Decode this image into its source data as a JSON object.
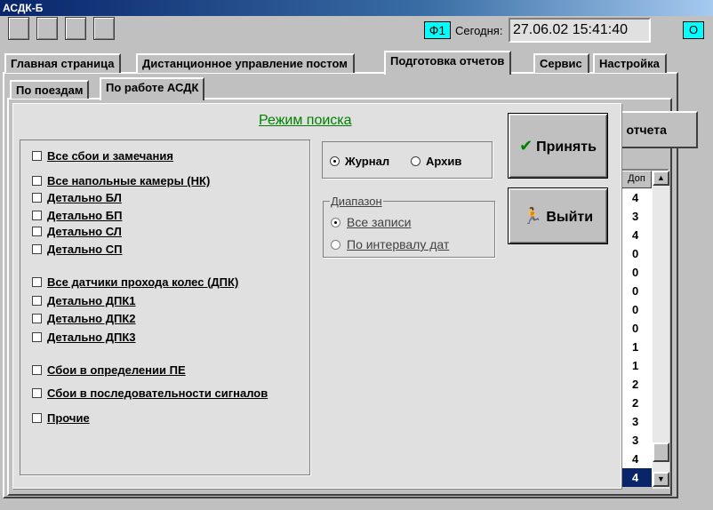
{
  "window": {
    "title": "АСДК-Б"
  },
  "header": {
    "f1_label": "Ф1",
    "today_label": "Сегодня:",
    "datetime": "27.06.02 15:41:40",
    "o_label": "О"
  },
  "main_tabs": [
    {
      "label": "Главная страница"
    },
    {
      "label": "Дистанционное управление постом"
    },
    {
      "label": "Подготовка отчетов"
    },
    {
      "label": "Сервис"
    },
    {
      "label": "Настройка"
    }
  ],
  "sub_tabs": [
    {
      "label": "По поездам"
    },
    {
      "label": "По работе АСДК"
    }
  ],
  "background": {
    "report_button_label": "ь отчета",
    "grid_header": "Доп",
    "grid_values": [
      "4",
      "3",
      "4",
      "0",
      "0",
      "0",
      "0",
      "0",
      "1",
      "1",
      "2",
      "2",
      "3",
      "3",
      "4",
      "4"
    ]
  },
  "dialog": {
    "title": "Режим поиска",
    "checkboxes": [
      {
        "label": "Все сбои и замечания"
      },
      {
        "label": "Все напольные камеры (НК)"
      },
      {
        "label": "Детально БЛ"
      },
      {
        "label": "Детально БП"
      },
      {
        "label": "Детально СЛ"
      },
      {
        "label": "Детально СП"
      },
      {
        "label": "Все датчики прохода колес (ДПК)"
      },
      {
        "label": "Детально ДПК1"
      },
      {
        "label": "Детально ДПК2"
      },
      {
        "label": "Детально ДПК3"
      },
      {
        "label": "Сбои в определении ПЕ"
      },
      {
        "label": "Сбои в последовательности сигналов"
      },
      {
        "label": "Прочие"
      }
    ],
    "source": {
      "journal": "Журнал",
      "archive": "Архив"
    },
    "range": {
      "label": "Диапазон",
      "all": "Все записи",
      "interval": "По интервалу дат"
    },
    "accept_label": "Принять",
    "exit_label": "Выйти"
  },
  "colors": {
    "accent": "#00ffff",
    "title_green": "#008000",
    "selection": "#0a246a"
  }
}
